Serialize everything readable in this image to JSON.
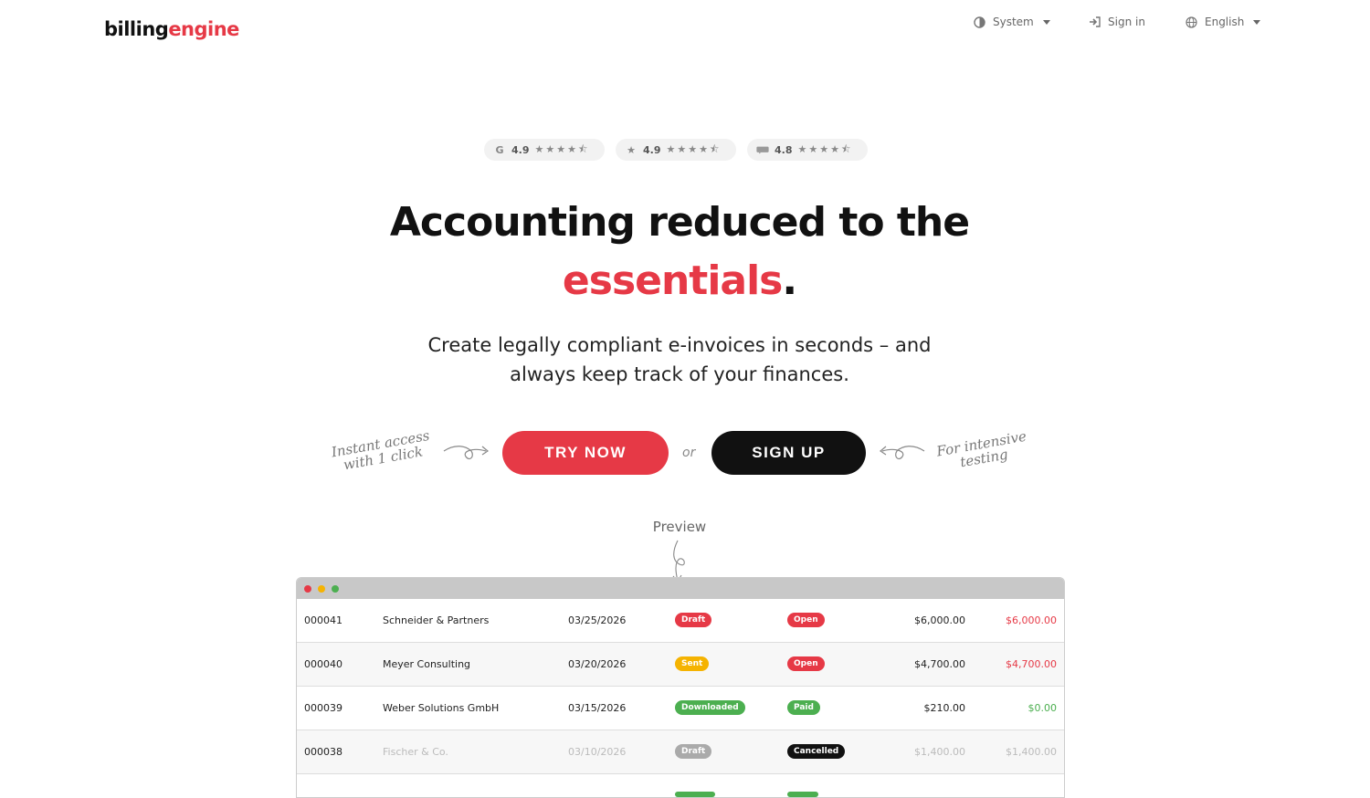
{
  "header": {
    "logo_part1": "billing",
    "logo_part2": "engine",
    "theme_label": "System",
    "signin_label": "Sign in",
    "language_label": "English"
  },
  "ratings": [
    {
      "source_icon": "google-icon",
      "score": "4.9",
      "stars": "★★★★⯪"
    },
    {
      "source_icon": "star-icon",
      "score": "4.9",
      "stars": "★★★★⯪"
    },
    {
      "source_icon": "omr-icon",
      "score": "4.8",
      "stars": "★★★★⯪"
    }
  ],
  "hero": {
    "title_line1": "Accounting reduced to the",
    "title_accent": "essentials",
    "title_period": ".",
    "subtitle_line1": "Create legally compliant e-invoices in seconds – and",
    "subtitle_line2": "always keep track of your finances."
  },
  "cta": {
    "try_label": "TRY NOW",
    "or_label": "or",
    "signup_label": "SIGN UP",
    "note_left_line1": "Instant access",
    "note_left_line2": "with 1 click",
    "note_right_line1": "For intensive",
    "note_right_line2": "testing"
  },
  "preview": {
    "label": "Preview",
    "rows": [
      {
        "number": "000041",
        "client": "Schneider & Partners",
        "date": "03/25/2026",
        "doc_status": "Draft",
        "pay_status": "Open",
        "amount": "$6,000.00",
        "balance": "$6,000.00"
      },
      {
        "number": "000040",
        "client": "Meyer Consulting",
        "date": "03/20/2026",
        "doc_status": "Sent",
        "pay_status": "Open",
        "amount": "$4,700.00",
        "balance": "$4,700.00"
      },
      {
        "number": "000039",
        "client": "Weber Solutions GmbH",
        "date": "03/15/2026",
        "doc_status": "Downloaded",
        "pay_status": "Paid",
        "amount": "$210.00",
        "balance": "$0.00"
      },
      {
        "number": "000038",
        "client": "Fischer & Co.",
        "date": "03/10/2026",
        "doc_status": "Draft",
        "pay_status": "Cancelled",
        "amount": "$1,400.00",
        "balance": "$1,400.00"
      }
    ]
  },
  "colors": {
    "accent": "#e63946",
    "dark": "#111111",
    "draft_badge": "#e63946",
    "draft_badge_muted": "#aaaaaa",
    "sent_badge": "#f5b301",
    "downloaded_badge": "#4caf50",
    "open_badge": "#e63946",
    "paid_badge": "#4caf50",
    "cancelled_badge": "#111111",
    "balance_open": "#e63946",
    "balance_paid": "#4caf50"
  }
}
